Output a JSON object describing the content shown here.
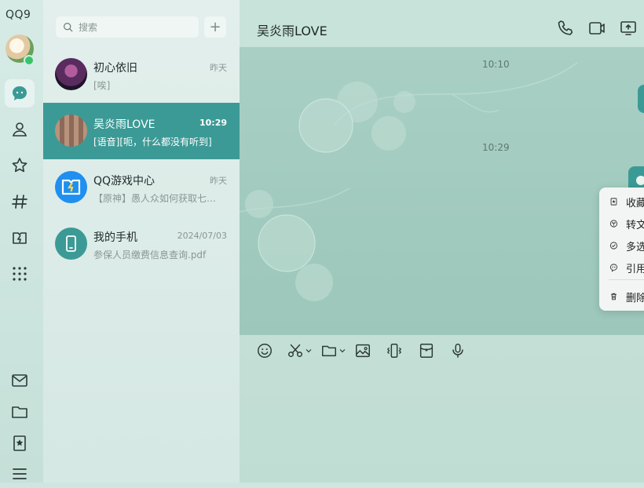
{
  "app": {
    "brand": "QQ9"
  },
  "search": {
    "placeholder": "搜索",
    "add_label": "+"
  },
  "conversations": [
    {
      "name": "初心依旧",
      "preview": "[唉]",
      "time": "昨天",
      "selected": false
    },
    {
      "name": "吴炎雨LOVE",
      "preview": "[语音][呃，什么都没有听到]",
      "time": "10:29",
      "selected": true
    },
    {
      "name": "QQ游戏中心",
      "preview": "【原神】愚人众如何获取七…",
      "time": "昨天",
      "selected": false
    },
    {
      "name": "我的手机",
      "preview": "参保人员缴费信息查询.pdf",
      "time": "2024/07/03",
      "selected": false
    }
  ],
  "chat": {
    "title": "吴炎雨LOVE",
    "timestamps": [
      "10:10",
      "10:29"
    ]
  },
  "context_menu": {
    "items": [
      {
        "icon": "bookmark-icon",
        "label": "收藏"
      },
      {
        "icon": "convert-text-icon",
        "label": "转文"
      },
      {
        "icon": "check-circle-icon",
        "label": "多选"
      },
      {
        "icon": "quote-icon",
        "label": "引用"
      },
      {
        "icon": "trash-icon",
        "label": "删除"
      }
    ]
  },
  "colors": {
    "accent": "#3c9a96",
    "online": "#35c56a"
  }
}
